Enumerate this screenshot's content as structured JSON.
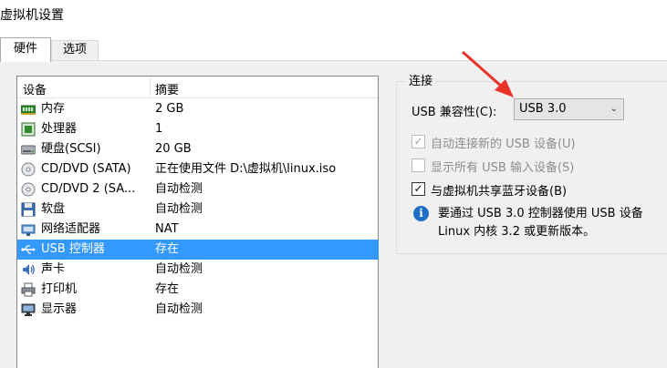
{
  "window": {
    "title": "虚拟机设置"
  },
  "tabs": [
    {
      "label": "硬件"
    },
    {
      "label": "选项"
    }
  ],
  "device_list": {
    "columns": {
      "device": "设备",
      "summary": "摘要"
    },
    "rows": [
      {
        "name": "内存",
        "summary": "2 GB",
        "icon": "memory-icon"
      },
      {
        "name": "处理器",
        "summary": "1",
        "icon": "processor-icon"
      },
      {
        "name": "硬盘(SCSI)",
        "summary": "20 GB",
        "icon": "hard-disk-icon"
      },
      {
        "name": "CD/DVD (SATA)",
        "summary": "正在使用文件 D:\\虚拟机\\linux.iso",
        "icon": "cd-dvd-icon"
      },
      {
        "name": "CD/DVD 2 (SA...",
        "summary": "自动检测",
        "icon": "cd-dvd-icon"
      },
      {
        "name": "软盘",
        "summary": "自动检测",
        "icon": "floppy-icon"
      },
      {
        "name": "网络适配器",
        "summary": "NAT",
        "icon": "network-adapter-icon"
      },
      {
        "name": "USB 控制器",
        "summary": "存在",
        "icon": "usb-icon",
        "selected": true
      },
      {
        "name": "声卡",
        "summary": "自动检测",
        "icon": "speaker-icon"
      },
      {
        "name": "打印机",
        "summary": "存在",
        "icon": "printer-icon"
      },
      {
        "name": "显示器",
        "summary": "自动检测",
        "icon": "monitor-icon"
      }
    ]
  },
  "connection": {
    "title": "连接",
    "compat_label": "USB 兼容性(C):",
    "compat_value": "USB 3.0",
    "options": [
      {
        "label": "自动连接新的 USB 设备(U)",
        "checked": true,
        "disabled": true
      },
      {
        "label": "显示所有 USB 输入设备(S)",
        "checked": false,
        "disabled": true
      },
      {
        "label": "与虚拟机共享蓝牙设备(B)",
        "checked": true,
        "disabled": false
      }
    ],
    "info_line1": "要通过 USB 3.0 控制器使用 USB 设备",
    "info_line2": "Linux 内核 3.2 或更新版本。"
  },
  "colors": {
    "selection": "#3399ff",
    "arrow": "#e8332a",
    "info": "#1e6ec8"
  }
}
